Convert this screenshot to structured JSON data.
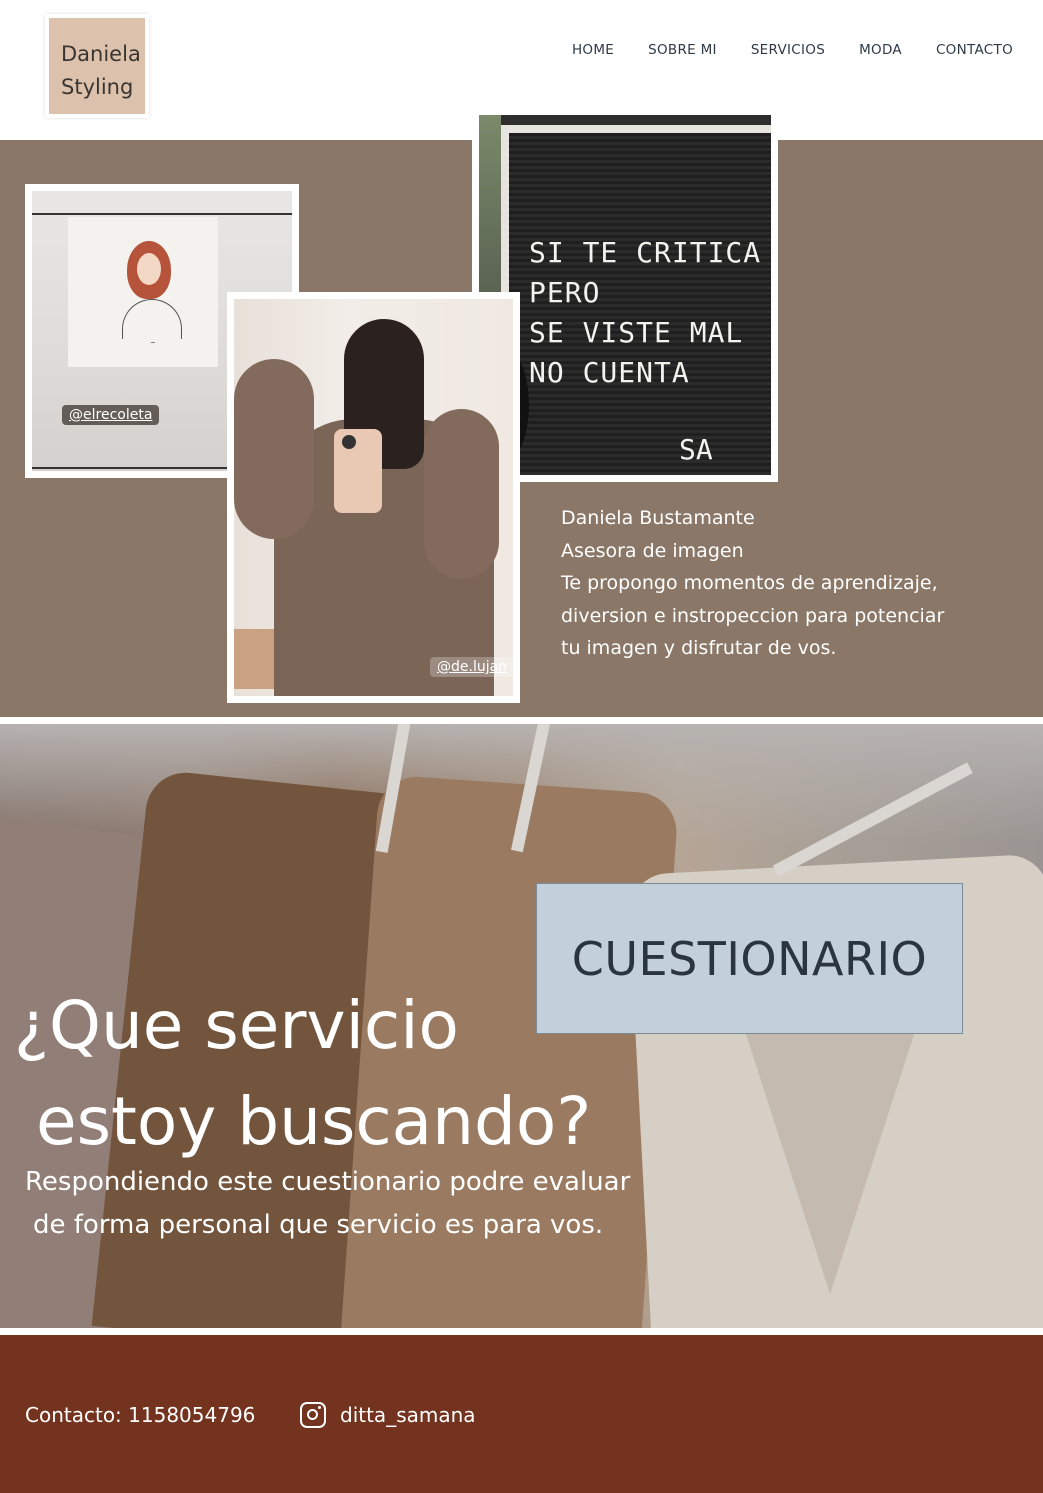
{
  "logo": {
    "line1": "Daniela",
    "line2": "Styling"
  },
  "nav": {
    "items": [
      {
        "label": "HOME"
      },
      {
        "label": "SOBRE MI"
      },
      {
        "label": "SERVICIOS"
      },
      {
        "label": "MODA"
      },
      {
        "label": "CONTACTO"
      }
    ]
  },
  "hero": {
    "photo1_tag": "@elrecoleta",
    "photo2_tag": "@de.lujan",
    "board_lines": [
      "SI TE CRITICA",
      "PERO",
      "SE VISTE MAL",
      "NO CUENTA"
    ],
    "board_sign": "SA",
    "bio": [
      "Daniela Bustamante",
      "Asesora de imagen",
      "Te propongo momentos de aprendizaje,",
      "diversion e instropeccion para potenciar",
      "tu imagen y disfrutar de vos."
    ]
  },
  "quiz": {
    "button_label": "CUESTIONARIO",
    "title_line1": "¿Que servicio",
    "title_line2": "estoy buscando?",
    "subtitle_line1": "Respondiendo este cuestionario podre evaluar",
    "subtitle_line2": "de forma personal que servicio es para vos."
  },
  "footer": {
    "contact": "Contacto: 1158054796",
    "instagram_handle": "ditta_samana",
    "instagram_icon": "instagram-icon"
  },
  "colors": {
    "hero_bg": "#8a7767",
    "logo_bg": "#dcc1ad",
    "quiz_button_bg": "#c3d0da",
    "footer_bg": "#73331f"
  }
}
